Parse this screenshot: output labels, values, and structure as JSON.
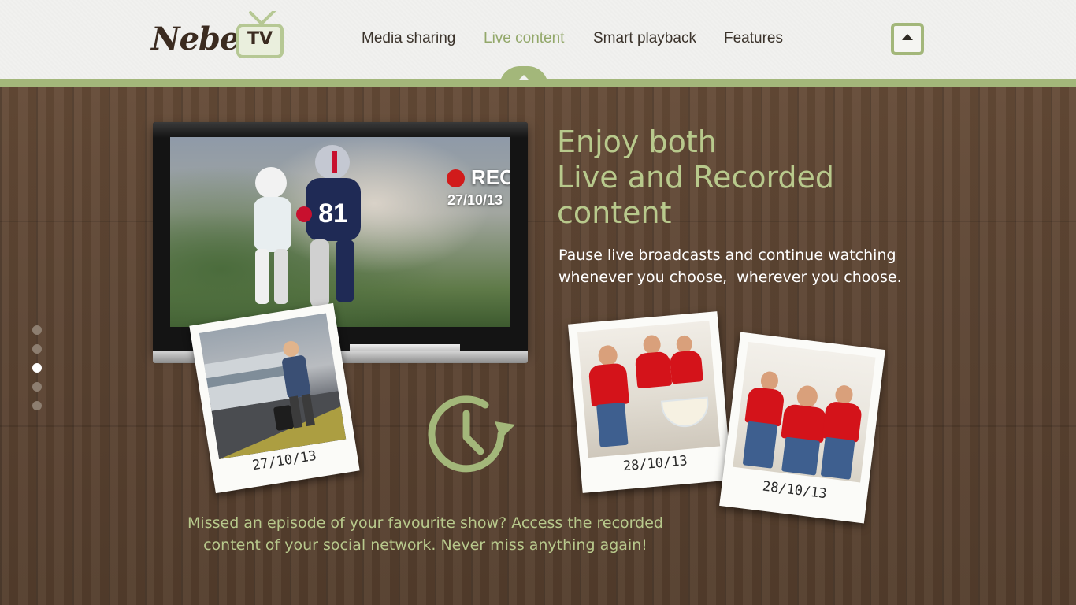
{
  "header": {
    "logo_text": "Nebel.",
    "logo_badge": "TV",
    "nav": [
      {
        "label": "Media sharing",
        "active": false
      },
      {
        "label": "Live content",
        "active": true
      },
      {
        "label": "Smart playback",
        "active": false
      },
      {
        "label": "Features",
        "active": false
      }
    ],
    "scroll_top_icon": "caret-up-icon"
  },
  "slide_dots": {
    "count": 5,
    "active_index": 2
  },
  "tv": {
    "rec_label": "REC",
    "rec_date": "27/10/13",
    "jersey_number": "81"
  },
  "hero": {
    "title_lines": [
      "Enjoy both",
      "Live and Recorded",
      "content"
    ],
    "subtitle_lines": [
      "Pause live broadcasts and continue watching",
      "whenever you choose,  wherever you choose."
    ]
  },
  "polaroids": [
    {
      "caption": "27/10/13"
    },
    {
      "caption": "28/10/13"
    },
    {
      "caption": "28/10/13"
    }
  ],
  "center_icon": "clock-replay-icon",
  "bottom": {
    "lines": [
      "Missed an episode of your favourite show? Access the recorded",
      "content of your social network. Never miss anything again!"
    ]
  },
  "colors": {
    "accent": "#a3b77a",
    "headline": "#b8c98c",
    "rec": "#d11b1b",
    "nav_active": "#93a86a"
  }
}
